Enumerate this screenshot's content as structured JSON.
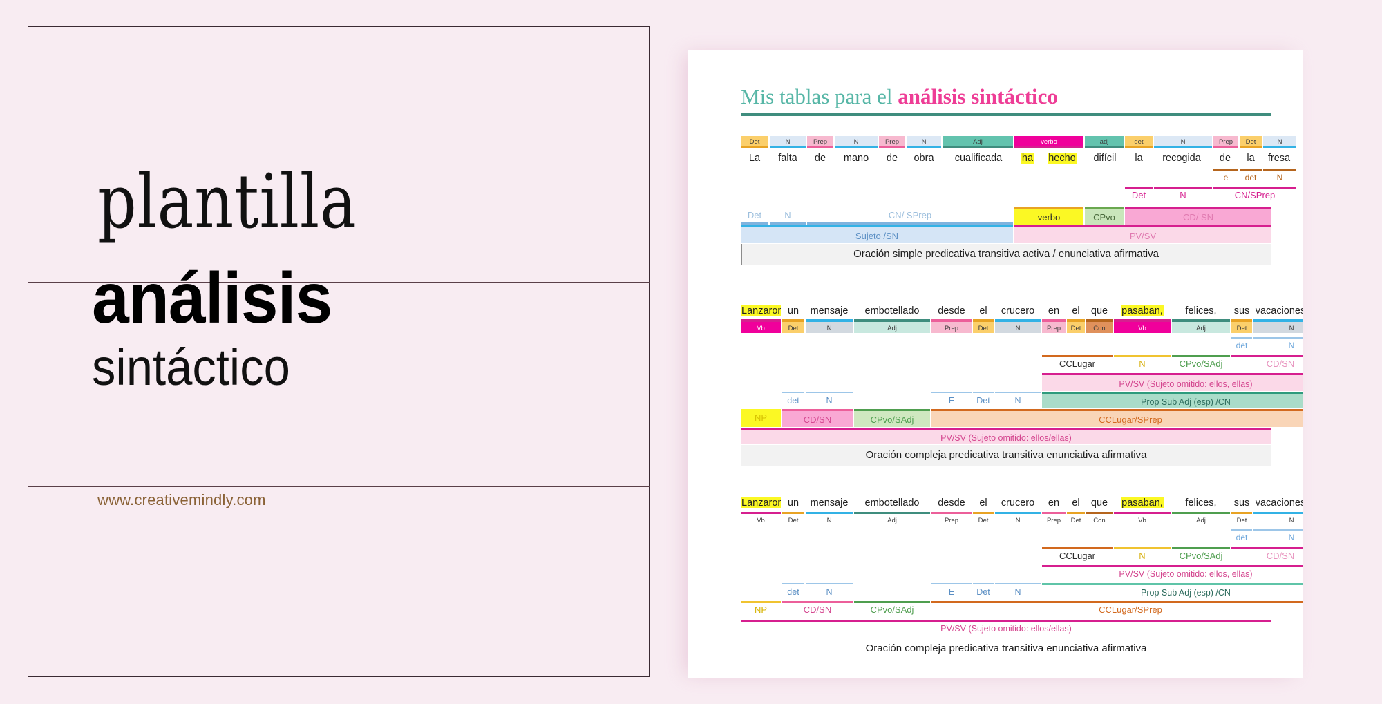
{
  "page": {
    "background": "#f8ecf2",
    "border_color": "#3a2a33"
  },
  "left_panel": {
    "line1": "plantilla",
    "line2": "análisis",
    "line3": "sintáctico",
    "url": "www.creativemindly.com",
    "url_color": "#8a6236"
  },
  "document": {
    "title_plain": "Mis tablas para el ",
    "title_accent": "análisis sintáctico",
    "title_plain_color": "#56b6a6",
    "title_accent_color": "#ee3d96",
    "underline_color": "#3f8d7e"
  },
  "colors": {
    "det_yellow": "#fbcf6b",
    "n_blue": "#dce8f5",
    "prep_pink": "#f7b9cf",
    "adj_teal": "#63c3ae",
    "verb_magenta": "#f0009b",
    "highlight_yellow": "#fbf824",
    "n_grey": "#d2d9e0",
    "adj_mint": "#c8e8df",
    "con_orange": "#e0915c",
    "cd_pink": "#f9a8d4",
    "sujeto_blue": "#d5e5f6",
    "pv_pink": "#fbd9e8",
    "cpvo_green": "#b8dda8",
    "cclugar_peach": "#f9d5b7",
    "prop_mint": "#aadcc9",
    "np_yellow": "#fbf824",
    "brown": "#b5651d",
    "magenta_line": "#d61f8f",
    "sentence_bg": "#f2f2f2"
  },
  "table1": {
    "words": [
      "La",
      "falta",
      "de",
      "mano",
      "de",
      "obra",
      "cualificada",
      "ha",
      "hecho",
      "difícil",
      "la",
      "recogida",
      "de",
      "la",
      "fresa"
    ],
    "highlighted_words": [
      "ha",
      "hecho"
    ],
    "pos_tags": [
      "Det",
      "N",
      "Prep",
      "N",
      "Prep",
      "N",
      "Adj",
      "verbo",
      "adj",
      "det",
      "N",
      "Prep",
      "Det",
      "N"
    ],
    "sub_row": [
      "e",
      "det",
      "N"
    ],
    "syntagma_row": [
      "Det",
      "N",
      "CN/SPrep"
    ],
    "function_row": [
      "Det",
      "N",
      "CN/ SPrep",
      "verbo",
      "CPvo",
      "CD/ SN"
    ],
    "constituent_row": [
      "Sujeto /SN",
      "PV/SV"
    ],
    "sentence": "Oración simple predicativa transitiva activa / enunciativa afirmativa"
  },
  "table2": {
    "words": [
      "Lanzaron",
      "un",
      "mensaje",
      "embotellado",
      "desde",
      "el",
      "crucero",
      "en",
      "el",
      "que",
      "pasaban,",
      "felices,",
      "sus",
      "vacaciones."
    ],
    "highlighted_words": [
      "Lanzaron",
      "pasaban,"
    ],
    "pos_tags": [
      "Vb",
      "Det",
      "N",
      "Adj",
      "Prep",
      "Det",
      "N",
      "Prep",
      "Det",
      "Con",
      "Vb",
      "Adj",
      "Det",
      "N"
    ],
    "sub_row_right": [
      "det",
      "N"
    ],
    "complement_row": [
      "CCLugar",
      "N",
      "CPvo/SAdj",
      "CD/SN"
    ],
    "pv_inner": "PV/SV (Sujeto omitido: ellos, ellas)",
    "prop_sub": "Prop Sub Adj (esp) /CN",
    "mid_row": [
      "det",
      "N",
      "E",
      "Det",
      "N"
    ],
    "function_row": [
      "NP",
      "CD/SN",
      "CPvo/SAdj",
      "CCLugar/SPrep"
    ],
    "pv_outer": "PV/SV (Sujeto omitido: ellos/ellas)",
    "sentence": "Oración compleja predicativa transitiva enunciativa afirmativa"
  },
  "table3": {
    "words": [
      "Lanzaron",
      "un",
      "mensaje",
      "embotellado",
      "desde",
      "el",
      "crucero",
      "en",
      "el",
      "que",
      "pasaban,",
      "felices,",
      "sus",
      "vacaciones."
    ],
    "highlighted_words": [
      "Lanzaron",
      "pasaban,"
    ],
    "pos_tags": [
      "Vb",
      "Det",
      "N",
      "Adj",
      "Prep",
      "Det",
      "N",
      "Prep",
      "Det",
      "Con",
      "Vb",
      "Adj",
      "Det",
      "N"
    ],
    "sub_row_right": [
      "det",
      "N"
    ],
    "complement_row": [
      "CCLugar",
      "N",
      "CPvo/SAdj",
      "CD/SN"
    ],
    "pv_inner": "PV/SV (Sujeto omitido: ellos, ellas)",
    "prop_sub": "Prop Sub Adj (esp) /CN",
    "mid_row": [
      "det",
      "N",
      "E",
      "Det",
      "N"
    ],
    "function_row": [
      "NP",
      "CD/SN",
      "CPvo/SAdj",
      "CCLugar/SPrep"
    ],
    "pv_outer": "PV/SV (Sujeto omitido: ellos/ellas)",
    "sentence": "Oración compleja predicativa transitiva enunciativa afirmativa"
  }
}
